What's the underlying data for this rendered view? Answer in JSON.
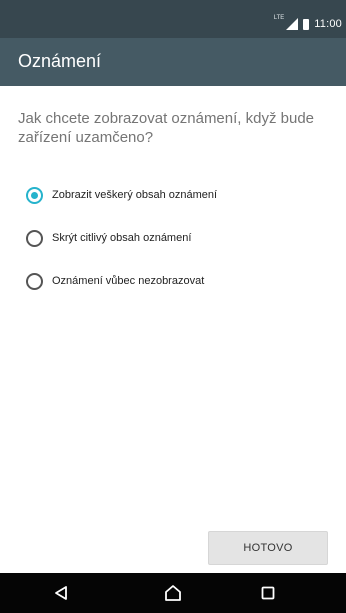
{
  "statusbar": {
    "network": "LTE",
    "time": "11:00"
  },
  "appbar": {
    "title": "Oznámení"
  },
  "question": "Jak chcete zobrazovat oznámení, když bude zařízení uzamčeno?",
  "options": [
    {
      "label": "Zobrazit veškerý obsah oznámení",
      "selected": true
    },
    {
      "label": "Skrýt citlivý obsah oznámení",
      "selected": false
    },
    {
      "label": "Oznámení vůbec nezobrazovat",
      "selected": false
    }
  ],
  "done_button": "HOTOVO",
  "colors": {
    "statusbar": "#37474f",
    "appbar": "#455a64",
    "accent": "#26b3cc",
    "navbar": "#050505"
  },
  "icons": {
    "signal": "signal-icon",
    "battery": "battery-icon",
    "back": "back-icon",
    "home": "home-icon",
    "recents": "recents-icon"
  }
}
